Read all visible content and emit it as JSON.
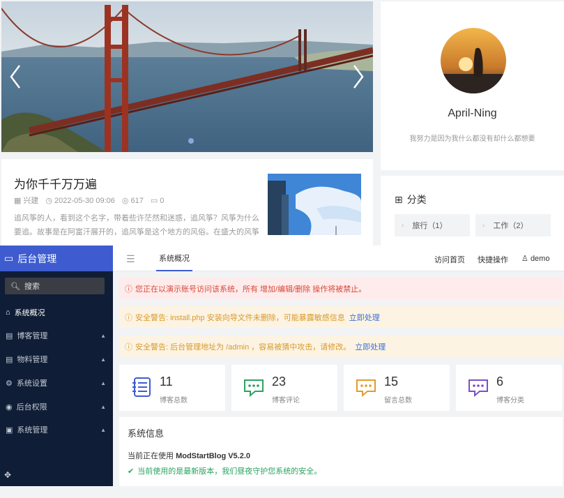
{
  "blog": {
    "post": {
      "title": "为你千千万万遍",
      "author": "兴建",
      "date": "2022-05-30 09:06",
      "views": "617",
      "comments": "0",
      "excerpt": "追风筝的人，看到这个名字，带着些许茫然和迷惑，追风筝？风筝为什么要追。故事是在阿富汗展开的，追风筝是这个地方的风俗。在盛大的风筝"
    },
    "profile": {
      "name": "April-Ning",
      "motto": "我努力是因为我什么都没有却什么都想要"
    },
    "categories": {
      "title": "分类",
      "items": [
        {
          "label": "旅行（1）"
        },
        {
          "label": "工作（2）"
        }
      ]
    }
  },
  "admin": {
    "brand": "后台管理",
    "search_label": "搜索",
    "nav": [
      {
        "label": "系统概况"
      },
      {
        "label": "博客管理"
      },
      {
        "label": "物料管理"
      },
      {
        "label": "系统设置"
      },
      {
        "label": "后台权限"
      },
      {
        "label": "系统管理"
      }
    ],
    "tab": "系统概况",
    "top_links": {
      "home": "访问首页",
      "shortcut": "快捷操作",
      "user": "demo"
    },
    "alerts": {
      "demo": "您正在以演示账号访问该系统，所有 增加/编辑/删除 操作将被禁止。",
      "install": "安全警告: install.php 安装向导文件未删除，可能暴露敏感信息",
      "install_link": "立即处理",
      "path": "安全警告: 后台管理地址为 /admin ，容易被猜中攻击，请修改。",
      "path_link": "立即处理"
    },
    "stats": [
      {
        "value": "11",
        "label": "博客总数",
        "color": "#3e5ccf"
      },
      {
        "value": "23",
        "label": "博客评论",
        "color": "#2aa35f"
      },
      {
        "value": "15",
        "label": "留言总数",
        "color": "#e39b2d"
      },
      {
        "value": "6",
        "label": "博客分类",
        "color": "#7a4fc8"
      }
    ],
    "sysinfo": {
      "title": "系统信息",
      "using_prefix": "当前正在使用",
      "version": "ModStartBlog V5.2.0",
      "latest": "当前使用的是最新版本，我们昼夜守护您系统的安全。"
    }
  }
}
